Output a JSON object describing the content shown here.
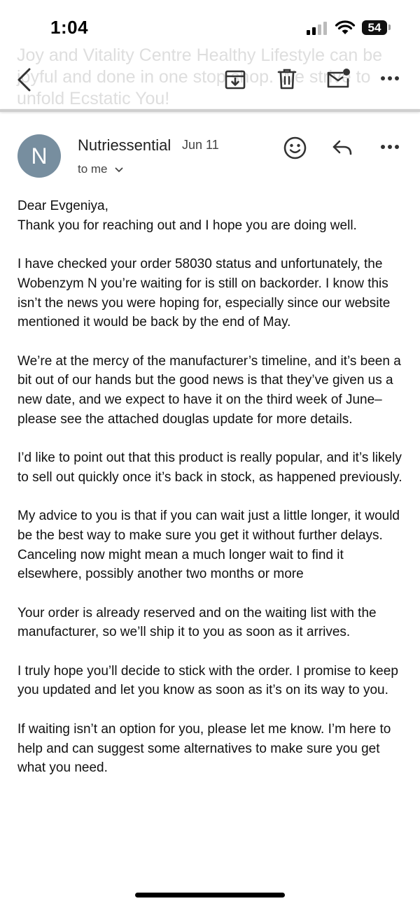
{
  "status_bar": {
    "time": "1:04",
    "battery": "54"
  },
  "subject": "Joy and Vitality Centre Healthy Lifestyle can be joyful and done in one stop shop. We strive to unfold Ecstatic You!",
  "toolbar": {
    "back_icon": "back-arrow-icon",
    "archive_icon": "archive-icon",
    "delete_icon": "trash-icon",
    "mark_unread_icon": "mark-unread-icon",
    "more_icon": "more-horizontal-icon"
  },
  "message": {
    "avatar_letter": "N",
    "avatar_color": "#778e9f",
    "sender": "Nutriessential",
    "date": "Jun 11",
    "recipient": "to me",
    "paragraphs": [
      "Dear Evgeniya,",
      "Thank you for reaching out and I hope you are doing well.",
      "I have checked your order 58030 status and unfortunately, the Wobenzym N you’re waiting for is still on backorder. I know this isn’t the news you were hoping for, especially since our website mentioned it would be back by the end of May.",
      "We’re at the mercy of the manufacturer’s timeline, and it’s been a bit out of our hands but the good news is that they’ve given us a new date, and we expect to have it on the third week of June– please see the attached douglas update for more details.",
      "I’d like to point out that this product is really popular, and it’s likely to sell out quickly once it’s back in stock, as happened previously.",
      "My advice to you is that if you can wait just a little longer, it would be the best way to make sure you get it without further delays. Canceling now might mean a much longer wait to find it elsewhere, possibly another two months or more",
      "Your order is already reserved and on the waiting list with the manufacturer, so we’ll ship it to you as soon as it arrives.",
      "I truly hope you’ll decide to stick with the order. I promise to keep you updated and let you know as soon as it’s on its way to you.",
      "If waiting isn’t an option for you, please let me know. I’m here to help and can suggest some alternatives to make sure you get what you need."
    ]
  }
}
